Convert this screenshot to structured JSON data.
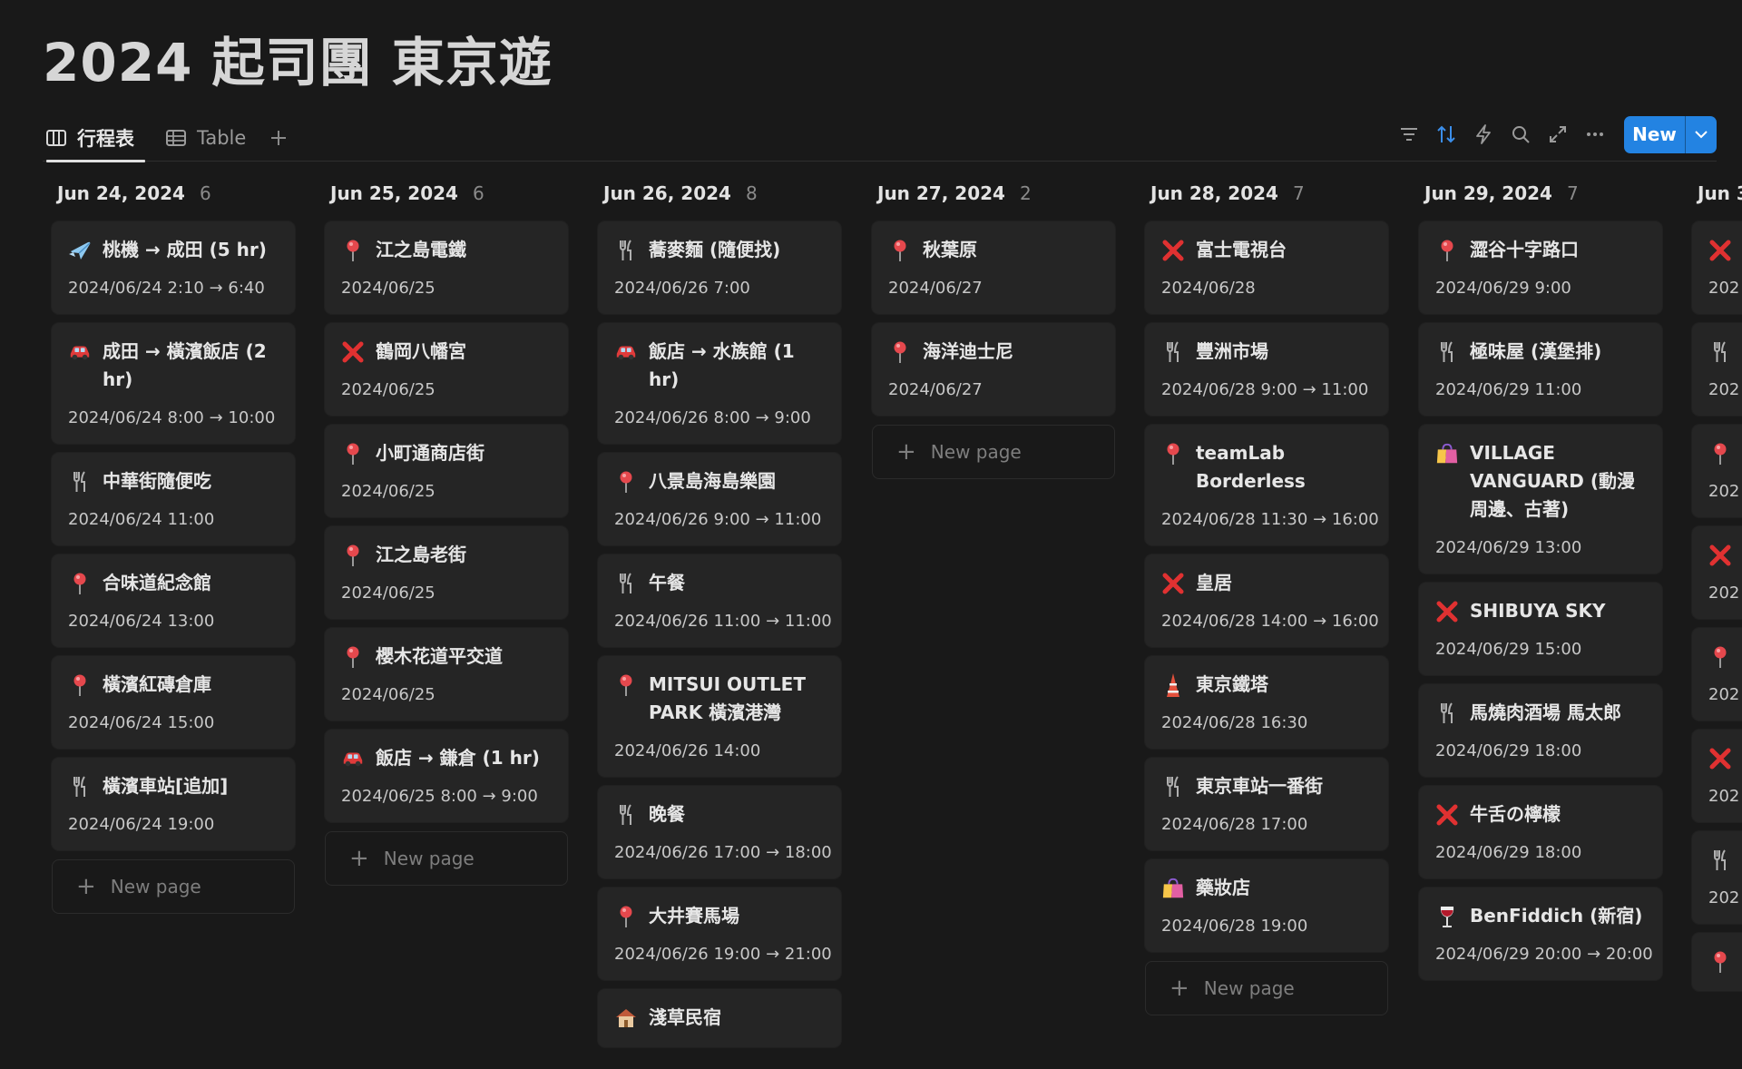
{
  "page": {
    "title": "2024 起司團 東京遊"
  },
  "views": {
    "tabs": [
      {
        "label": "行程表",
        "active": true,
        "icon": "board-icon"
      },
      {
        "label": "Table",
        "active": false,
        "icon": "table-icon"
      }
    ]
  },
  "toolbar": {
    "new_label": "New"
  },
  "board": {
    "new_page_label": "New page",
    "columns": [
      {
        "title": "Jun 24, 2024",
        "count": "6",
        "cards": [
          {
            "icon": "airplane",
            "title": "桃機 → 成田 (5 hr)",
            "date": "2024/06/24 2:10 → 6:40"
          },
          {
            "icon": "car",
            "title": "成田 → 橫濱飯店 (2 hr)",
            "date": "2024/06/24 8:00 → 10:00"
          },
          {
            "icon": "fork-knife",
            "title": "中華街隨便吃",
            "date": "2024/06/24 11:00"
          },
          {
            "icon": "pin",
            "title": "合味道紀念館",
            "date": "2024/06/24 13:00"
          },
          {
            "icon": "pin",
            "title": "橫濱紅磚倉庫",
            "date": "2024/06/24 15:00"
          },
          {
            "icon": "fork-knife",
            "title": "橫濱車站[追加]",
            "date": "2024/06/24 19:00"
          }
        ],
        "show_new": true
      },
      {
        "title": "Jun 25, 2024",
        "count": "6",
        "cards": [
          {
            "icon": "pin",
            "title": "江之島電鐵",
            "date": "2024/06/25"
          },
          {
            "icon": "cross",
            "title": "鶴岡八幡宮",
            "date": "2024/06/25"
          },
          {
            "icon": "pin",
            "title": "小町通商店街",
            "date": "2024/06/25"
          },
          {
            "icon": "pin",
            "title": "江之島老街",
            "date": "2024/06/25"
          },
          {
            "icon": "pin",
            "title": "櫻木花道平交道",
            "date": "2024/06/25"
          },
          {
            "icon": "car",
            "title": "飯店 → 鎌倉 (1 hr)",
            "date": "2024/06/25 8:00 → 9:00"
          }
        ],
        "show_new": true
      },
      {
        "title": "Jun 26, 2024",
        "count": "8",
        "cards": [
          {
            "icon": "fork-knife",
            "title": "蕎麥麵 (隨便找)",
            "date": "2024/06/26 7:00"
          },
          {
            "icon": "car",
            "title": "飯店 → 水族館 (1 hr)",
            "date": "2024/06/26 8:00 → 9:00"
          },
          {
            "icon": "pin",
            "title": "八景島海島樂園",
            "date": "2024/06/26 9:00 → 11:00"
          },
          {
            "icon": "fork-knife",
            "title": "午餐",
            "date": "2024/06/26 11:00 → 11:00"
          },
          {
            "icon": "pin",
            "title": "MITSUI OUTLET PARK 橫濱港灣",
            "date": "2024/06/26 14:00"
          },
          {
            "icon": "fork-knife",
            "title": "晚餐",
            "date": "2024/06/26 17:00 → 18:00"
          },
          {
            "icon": "pin",
            "title": "大井賽馬場",
            "date": "2024/06/26 19:00 → 21:00"
          },
          {
            "icon": "house",
            "title": "淺草民宿",
            "date": ""
          }
        ],
        "show_new": false
      },
      {
        "title": "Jun 27, 2024",
        "count": "2",
        "cards": [
          {
            "icon": "pin",
            "title": "秋葉原",
            "date": "2024/06/27"
          },
          {
            "icon": "pin",
            "title": "海洋迪士尼",
            "date": "2024/06/27"
          }
        ],
        "show_new": true
      },
      {
        "title": "Jun 28, 2024",
        "count": "7",
        "cards": [
          {
            "icon": "cross",
            "title": "富士電視台",
            "date": "2024/06/28"
          },
          {
            "icon": "fork-knife",
            "title": "豐洲市場",
            "date": "2024/06/28 9:00 → 11:00"
          },
          {
            "icon": "pin",
            "title": "teamLab Borderless",
            "date": "2024/06/28 11:30 → 16:00"
          },
          {
            "icon": "cross",
            "title": "皇居",
            "date": "2024/06/28 14:00 → 16:00"
          },
          {
            "icon": "tower",
            "title": "東京鐵塔",
            "date": "2024/06/28 16:30"
          },
          {
            "icon": "fork-knife",
            "title": "東京車站一番街",
            "date": "2024/06/28 17:00"
          },
          {
            "icon": "shopping-bag",
            "title": "藥妝店",
            "date": "2024/06/28 19:00"
          }
        ],
        "show_new": true
      },
      {
        "title": "Jun 29, 2024",
        "count": "7",
        "cards": [
          {
            "icon": "pin",
            "title": "澀谷十字路口",
            "date": "2024/06/29 9:00"
          },
          {
            "icon": "fork-knife",
            "title": "極味屋 (漢堡排)",
            "date": "2024/06/29 11:00"
          },
          {
            "icon": "shopping-bag",
            "title": "VILLAGE VANGUARD (動漫周邊、古著)",
            "date": "2024/06/29 13:00"
          },
          {
            "icon": "cross",
            "title": "SHIBUYA SKY",
            "date": "2024/06/29 15:00"
          },
          {
            "icon": "fork-knife",
            "title": "馬燒肉酒場 馬太郎",
            "date": "2024/06/29 18:00"
          },
          {
            "icon": "cross",
            "title": "牛舌の檸檬",
            "date": "2024/06/29 18:00"
          },
          {
            "icon": "wine",
            "title": "BenFiddich (新宿)",
            "date": "2024/06/29 20:00 → 20:00"
          }
        ],
        "show_new": false
      },
      {
        "title": "Jun 3",
        "count": "",
        "cards": [
          {
            "icon": "cross",
            "title": "",
            "date": "202"
          },
          {
            "icon": "fork-knife",
            "title": "",
            "date": "202"
          },
          {
            "icon": "pin",
            "title": "",
            "date": "202"
          },
          {
            "icon": "cross",
            "title": "",
            "date": "202"
          },
          {
            "icon": "pin",
            "title": "",
            "date": "202"
          },
          {
            "icon": "cross",
            "title": "",
            "date": "202"
          },
          {
            "icon": "fork-knife",
            "title": "",
            "date": "202"
          },
          {
            "icon": "pin",
            "title": "",
            "date": ""
          }
        ],
        "show_new": false
      }
    ]
  },
  "colors": {
    "accent": "#2383e2",
    "card_bg": "#252525",
    "page_bg": "#191919",
    "cross": "#e03131",
    "pin": "#e5484d"
  }
}
